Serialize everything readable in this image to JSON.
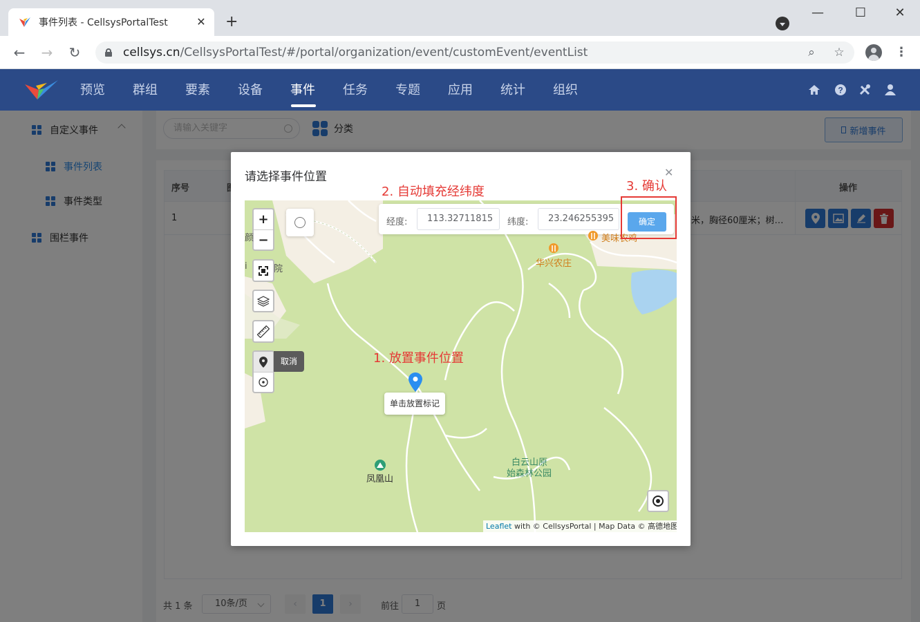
{
  "browser": {
    "tab_title": "事件列表 - CellsysPortalTest",
    "url_host": "cellsys.cn",
    "url_path": "/CellsysPortalTest/#/portal/organization/event/customEvent/eventList"
  },
  "nav": {
    "items": [
      "预览",
      "群组",
      "要素",
      "设备",
      "事件",
      "任务",
      "专题",
      "应用",
      "统计",
      "组织"
    ],
    "active": "事件"
  },
  "sidebar": {
    "group1": "自定义事件",
    "sub1": "事件列表",
    "sub2": "事件类型",
    "group2": "围栏事件"
  },
  "toolbar": {
    "search_placeholder": "请输入关键字",
    "category_label": "分类",
    "add_label": "新增事件"
  },
  "table": {
    "headers": [
      "序号",
      "图",
      "操作"
    ],
    "row": {
      "index": "1",
      "desc": "米，胸径60厘米；树…"
    }
  },
  "pagination": {
    "total": "共 1 条",
    "page_size": "10条/页",
    "current": "1",
    "goto_label": "前往",
    "goto_value": "1",
    "page_suffix": "页"
  },
  "dialog": {
    "title": "请选择事件位置",
    "lng_label": "经度:",
    "lng_value": "113.32711815",
    "lat_label": "纬度:",
    "lat_value": "23.246255395",
    "confirm_label": "确定",
    "cancel_tip": "取消",
    "place_tip": "单击放置标记",
    "attribution_link": "Leaflet",
    "attribution_text": " with © CellsysPortal | Map Data © 高德地图"
  },
  "map_labels": {
    "restaurant": "美味农鸡",
    "farm": "华兴农庄",
    "mountain": "凤凰山",
    "park_line1": "白云山原",
    "park_line2": "始森林公园",
    "left_frag1": "颜",
    "left_frag2": "i",
    "left_frag3": "院"
  },
  "annotations": {
    "step1": "1. 放置事件位置",
    "step2": "2. 自动填充经纬度",
    "step3": "3. 确认"
  },
  "colors": {
    "header_bg": "#2b4a87",
    "accent": "#2e78d4",
    "map_green": "#cfe3a6",
    "annotation_red": "#e53935"
  }
}
